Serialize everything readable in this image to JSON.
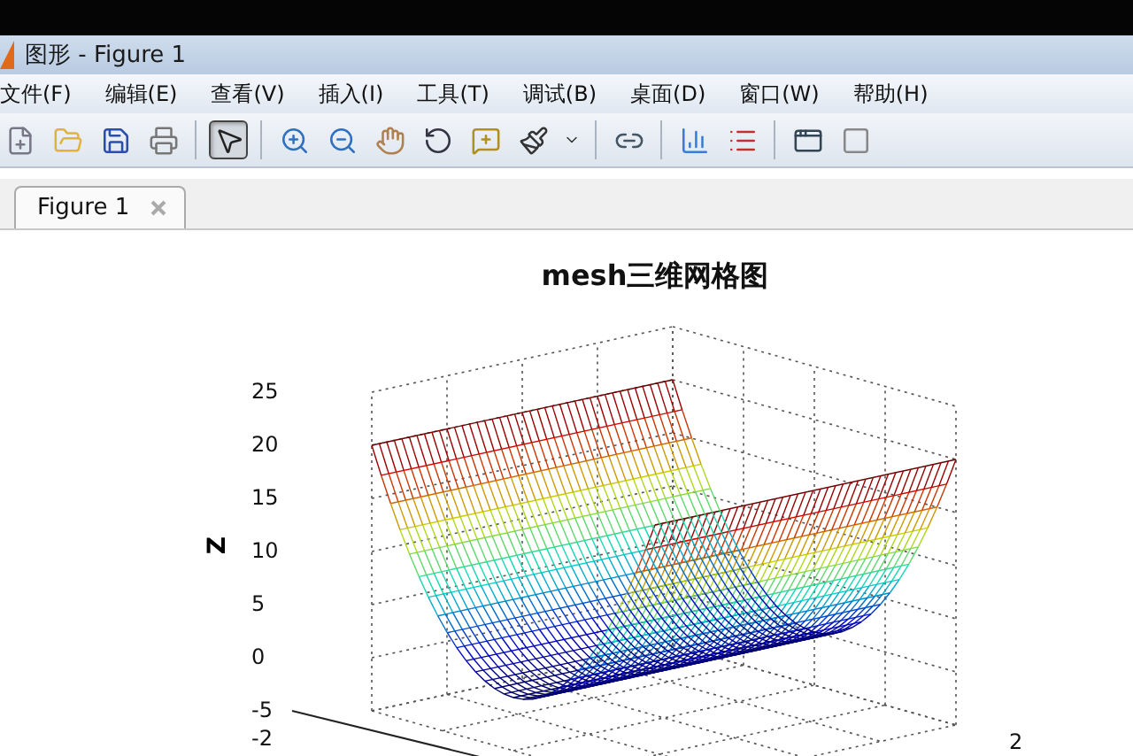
{
  "window": {
    "title": "图形 - Figure 1"
  },
  "menu": [
    "文件(F)",
    "编辑(E)",
    "查看(V)",
    "插入(I)",
    "工具(T)",
    "调试(B)",
    "桌面(D)",
    "窗口(W)",
    "帮助(H)"
  ],
  "toolbar": [
    [
      {
        "kind": "new",
        "selected": false
      },
      {
        "kind": "open",
        "selected": false
      },
      {
        "kind": "save",
        "selected": false
      },
      {
        "kind": "print",
        "selected": false
      }
    ],
    [
      {
        "kind": "pointer",
        "selected": true
      }
    ],
    [
      {
        "kind": "zoomin",
        "selected": false
      },
      {
        "kind": "zoomout",
        "selected": false
      },
      {
        "kind": "pan",
        "selected": false
      },
      {
        "kind": "rotate",
        "selected": false
      },
      {
        "kind": "cursor",
        "selected": false
      },
      {
        "kind": "brush",
        "selected": false
      },
      {
        "kind": "caret",
        "selected": false
      }
    ],
    [
      {
        "kind": "link",
        "selected": false
      }
    ],
    [
      {
        "kind": "colorbar",
        "selected": false
      },
      {
        "kind": "legend",
        "selected": false
      }
    ],
    [
      {
        "kind": "window",
        "selected": false
      },
      {
        "kind": "tools",
        "selected": false
      }
    ]
  ],
  "tabs": [
    {
      "label": "Figure 1",
      "selected": true
    }
  ],
  "figure": {
    "title": "mesh三维网格图",
    "zlabel": "Z",
    "z_ticks": [
      "25",
      "20",
      "15",
      "10",
      "5",
      "0",
      "-5"
    ],
    "x_ticks": [
      "-2"
    ],
    "y_ticks": [
      "2"
    ]
  }
}
